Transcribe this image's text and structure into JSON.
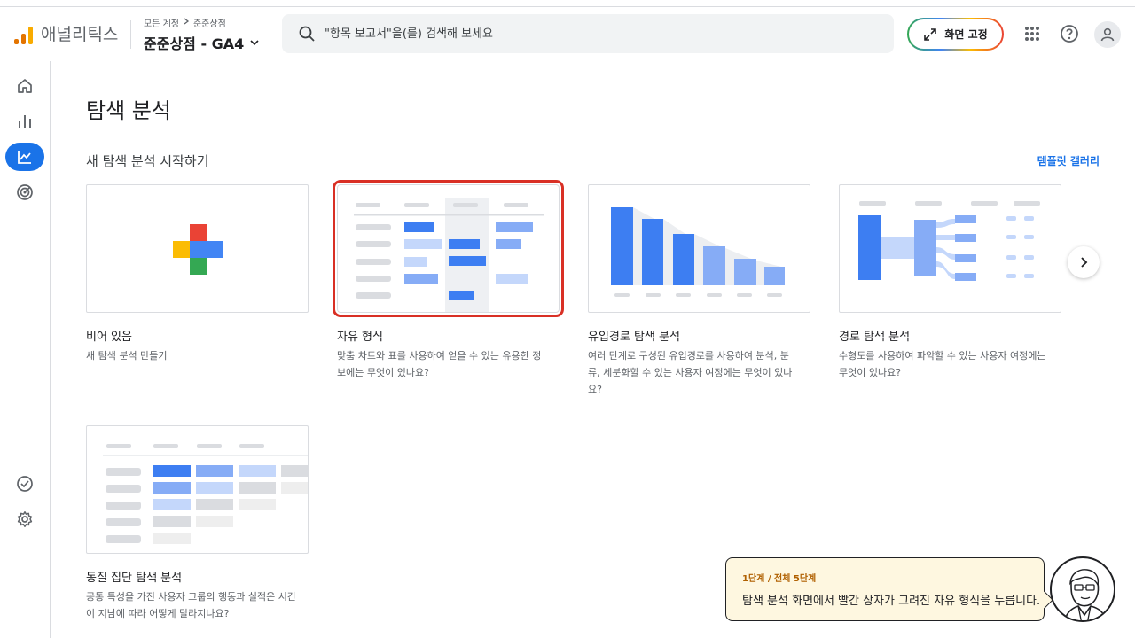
{
  "header": {
    "app_name": "애널리틱스",
    "breadcrumb": [
      "모든 계정",
      "준준상점"
    ],
    "property": "준준상점 - GA4",
    "search_placeholder": "\"항목 보고서\"을(를) 검색해 보세요",
    "pin_button": "화면 고정"
  },
  "nav": {
    "items": [
      {
        "name": "home-icon",
        "active": false
      },
      {
        "name": "reports-icon",
        "active": false
      },
      {
        "name": "explore-icon",
        "active": true
      },
      {
        "name": "advertising-icon",
        "active": false
      }
    ],
    "bottom": [
      {
        "name": "check-circle-icon"
      },
      {
        "name": "settings-icon"
      }
    ]
  },
  "main": {
    "title": "탐색 분석",
    "section_title": "새 탐색 분석 시작하기",
    "gallery_link": "템플릿 갤러리",
    "cards": [
      {
        "title": "비어 있음",
        "desc": "새 탐색 분석 만들기"
      },
      {
        "title": "자유 형식",
        "desc": "맞춤 차트와 표를 사용하여 얻을 수 있는 유용한 정보에는 무엇이 있나요?"
      },
      {
        "title": "유입경로 탐색 분석",
        "desc": "여러 단계로 구성된 유입경로를 사용하여 분석, 분류, 세분화할 수 있는 사용자 여정에는 무엇이 있나요?"
      },
      {
        "title": "경로 탐색 분석",
        "desc": "수형도를 사용하여 파악할 수 있는 사용자 여정에는 무엇이 있나요?"
      },
      {
        "title": "동질 집단 탐색 분석",
        "desc": "공통 특성을 가진 사용자 그룹의 행동과 실적은 시간이 지남에 따라 어떻게 달라지나요?"
      }
    ]
  },
  "guide": {
    "step": "1단계 / 전체 5단계",
    "text": "탐색 분석 화면에서 빨간 상자가 그려진 자유 형식을 누릅니다."
  },
  "colors": {
    "accent": "#1a73e8",
    "highlight": "#d93025",
    "guide_bg": "#fef7e0"
  }
}
